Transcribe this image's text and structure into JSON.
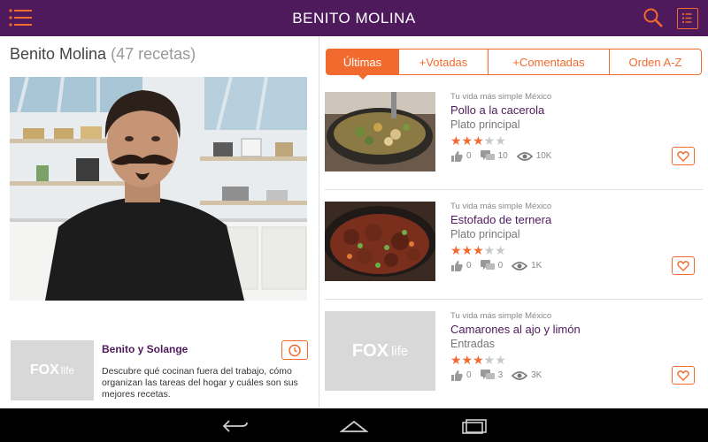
{
  "app": {
    "title": "BENITO MOLINA"
  },
  "chef": {
    "name": "Benito Molina",
    "count": "(47 recetas)"
  },
  "show": {
    "title": "Benito y Solange",
    "description": "Descubre qué cocinan fuera del trabajo, cómo organizan las tareas del hogar y cuáles son sus mejores recetas.",
    "logo_text": "FOX",
    "logo_sub": "life"
  },
  "tabs": [
    {
      "label": "Últimas",
      "active": true
    },
    {
      "label": "+Votadas",
      "active": false
    },
    {
      "label": "+Comentadas",
      "active": false
    },
    {
      "label": "Orden A-Z",
      "active": false
    }
  ],
  "recipes": [
    {
      "source": "Tu vida más simple México",
      "name": "Pollo a la cacerola",
      "category": "Plato principal",
      "rating": 3,
      "likes": "0",
      "comments": "10",
      "views": "10K"
    },
    {
      "source": "Tu vida más simple México",
      "name": "Estofado de ternera",
      "category": "Plato principal",
      "rating": 3,
      "likes": "0",
      "comments": "0",
      "views": "1K"
    },
    {
      "source": "Tu vida más simple México",
      "name": "Camarones al ajo y limón",
      "category": "Entradas",
      "rating": 3,
      "likes": "0",
      "comments": "3",
      "views": "3K"
    }
  ],
  "colors": {
    "header": "#4e1a5c",
    "accent": "#f26a2e"
  },
  "icons": [
    "menu-icon",
    "search-icon",
    "list-icon",
    "alarm-clock-icon",
    "thumbs-up-icon",
    "comment-icon",
    "eye-icon",
    "heart-icon",
    "back-icon",
    "home-icon",
    "recents-icon"
  ]
}
